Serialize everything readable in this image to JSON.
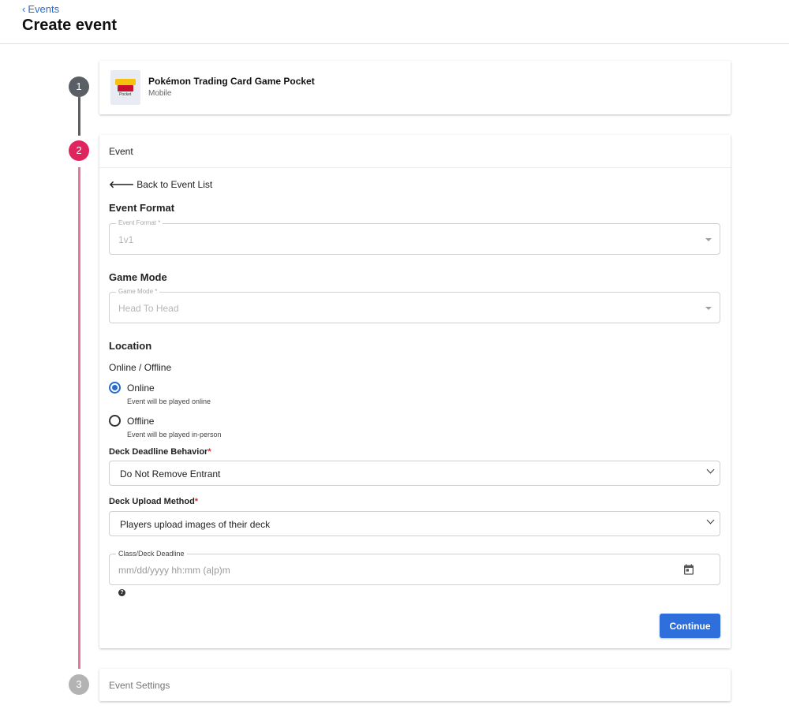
{
  "header": {
    "back_label": "Events",
    "title": "Create event"
  },
  "steps": [
    {
      "number": "1",
      "state": "completed"
    },
    {
      "number": "2",
      "state": "active"
    },
    {
      "number": "3",
      "state": "pending"
    }
  ],
  "game": {
    "name": "Pokémon Trading Card Game Pocket",
    "platform": "Mobile",
    "thumb_text": "Pocket"
  },
  "event_card": {
    "title": "Event",
    "back_to_list": "Back to Event List",
    "event_format": {
      "heading": "Event Format",
      "label": "Event Format *",
      "value": "1v1"
    },
    "game_mode": {
      "heading": "Game Mode",
      "label": "Game Mode *",
      "value": "Head To Head"
    },
    "location": {
      "heading": "Location",
      "sublabel": "Online / Offline",
      "options": [
        {
          "label": "Online",
          "help": "Event will be played online",
          "checked": true
        },
        {
          "label": "Offline",
          "help": "Event will be played in-person",
          "checked": false
        }
      ]
    },
    "deck_deadline_behavior": {
      "label": "Deck Deadline Behavior",
      "required_mark": "*",
      "value": "Do Not Remove Entrant"
    },
    "deck_upload_method": {
      "label": "Deck Upload Method",
      "required_mark": "*",
      "value": "Players upload images of their deck"
    },
    "deadline": {
      "label": "Class/Deck Deadline",
      "placeholder": "mm/dd/yyyy hh:mm (a|p)m"
    },
    "help_icon": "?",
    "continue_label": "Continue"
  },
  "settings_card": {
    "title": "Event Settings"
  },
  "icons": {
    "back": "chevron-left-icon",
    "back_list": "arrow-left-icon",
    "calendar": "calendar-icon",
    "help": "question-circle-icon"
  },
  "colors": {
    "accent": "#2f6fdb",
    "link": "#2a6bc9",
    "step_active": "#e0245e",
    "step_line_active": "#e8789b",
    "step_completed": "#5a5f66",
    "step_pending": "#b3b3b3",
    "required": "#d32f2f"
  }
}
